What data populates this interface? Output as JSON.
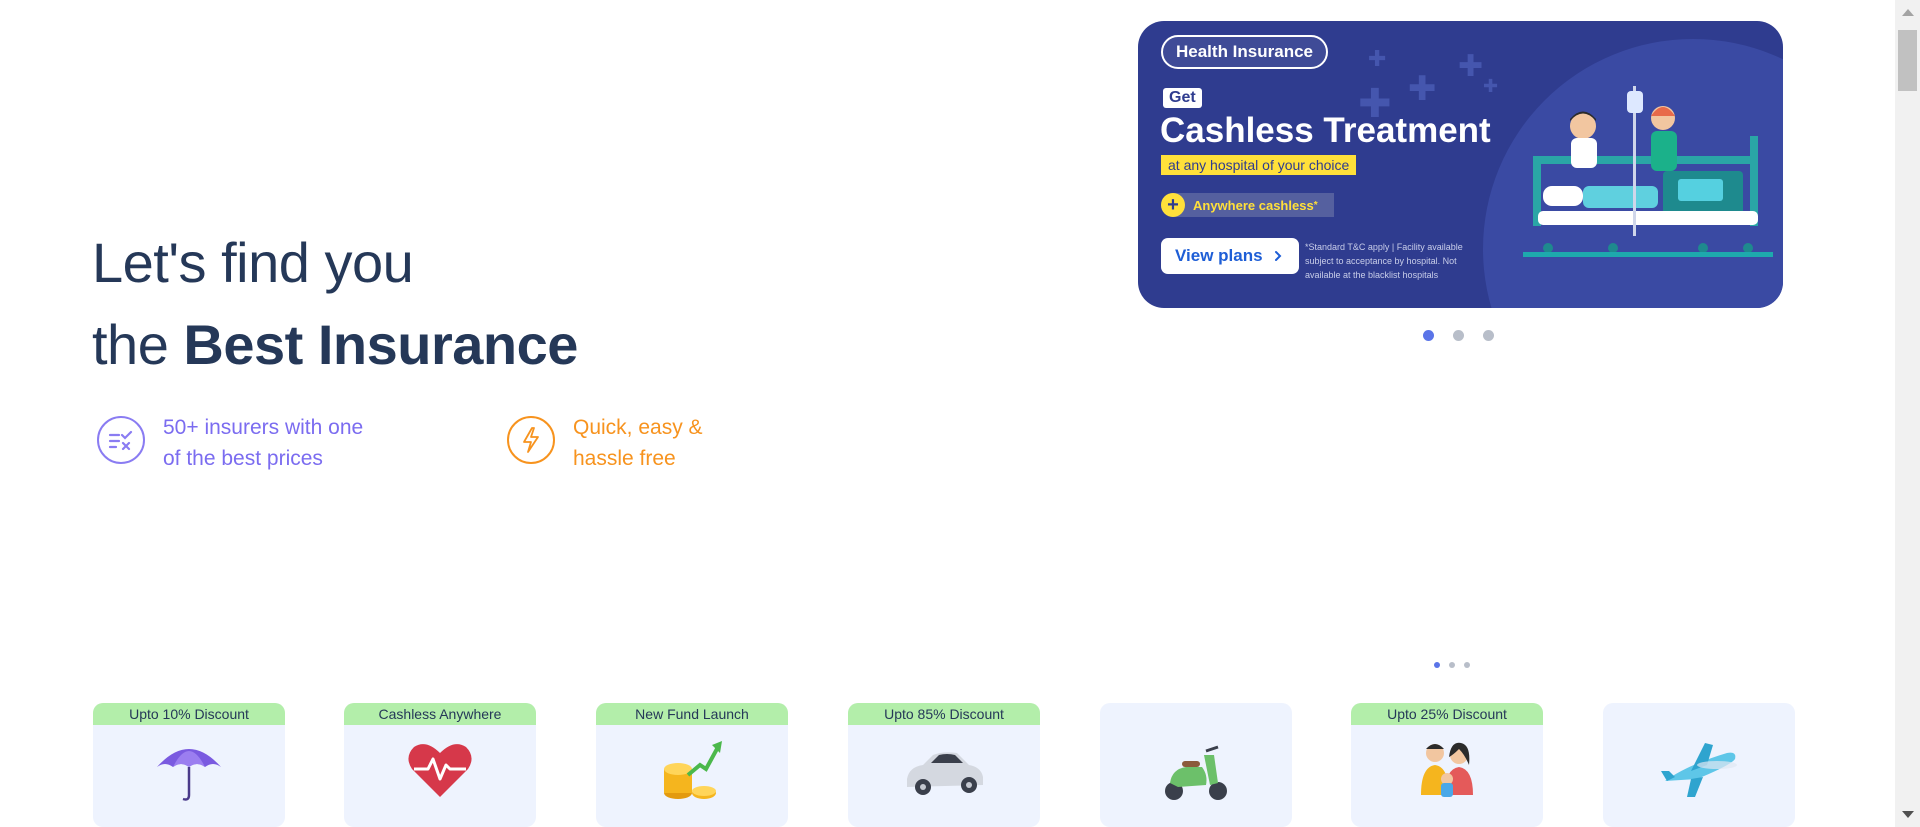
{
  "hero": {
    "line1": "Let's find you",
    "line2_prefix": "the ",
    "line2_bold": "Best Insurance"
  },
  "features": [
    {
      "icon": "compare-list-icon",
      "line1": "50+ insurers with one",
      "line2": "of the best prices",
      "color": "#7b6cf0"
    },
    {
      "icon": "lightning-icon",
      "line1": "Quick, easy &",
      "line2": "hassle free",
      "color": "#f7931e"
    }
  ],
  "banner": {
    "pill": "Health Insurance",
    "get": "Get",
    "headline": "Cashless Treatment",
    "highlight": "at any hospital of your choice",
    "anywhere": "Anywhere cashless",
    "anywhere_mark": "*",
    "button": "View plans",
    "disclaimer": "*Standard T&C apply | Facility available subject to acceptance by hospital. Not available at the blacklist hospitals",
    "bg_color": "#2f3c8f",
    "accent_yellow": "#ffe03a"
  },
  "carousel_main": {
    "count": 3,
    "active": 0
  },
  "carousel_secondary": {
    "count": 3,
    "active": 0
  },
  "cards": [
    {
      "badge": "Upto 10% Discount",
      "icon": "umbrella-icon"
    },
    {
      "badge": "Cashless Anywhere",
      "icon": "heart-pulse-icon"
    },
    {
      "badge": "New Fund Launch",
      "icon": "coins-growth-icon"
    },
    {
      "badge": "Upto 85% Discount",
      "icon": "car-icon"
    },
    {
      "badge": "",
      "icon": "scooter-icon"
    },
    {
      "badge": "Upto 25% Discount",
      "icon": "family-icon"
    },
    {
      "badge": "",
      "icon": "airplane-icon"
    }
  ]
}
